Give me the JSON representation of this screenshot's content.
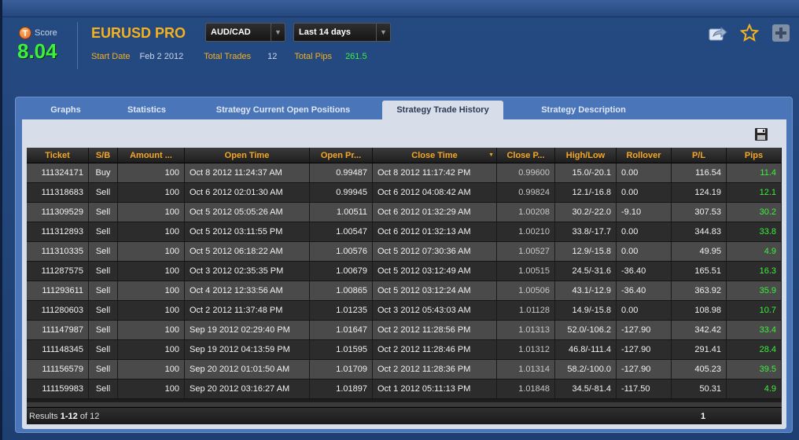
{
  "header": {
    "score_label": "Score",
    "score_icon_letter": "T",
    "score_value": "8.04",
    "strategy_name": "EURUSD PRO",
    "pair_select": "AUD/CAD",
    "period_select": "Last 14 days",
    "start_date_label": "Start Date",
    "start_date_value": "Feb 2 2012",
    "total_trades_label": "Total Trades",
    "total_trades_value": "12",
    "total_pips_label": "Total Pips",
    "total_pips_value": "261.5",
    "icons": [
      "share-icon",
      "star-icon",
      "plus-icon"
    ]
  },
  "tabs": [
    {
      "label": "Graphs",
      "active": false
    },
    {
      "label": "Statistics",
      "active": false
    },
    {
      "label": "Strategy Current Open Positions",
      "active": false
    },
    {
      "label": "Strategy Trade History",
      "active": true
    },
    {
      "label": "Strategy Description",
      "active": false
    }
  ],
  "grid": {
    "columns": [
      "Ticket",
      "S/B",
      "Amount ...",
      "Open Time",
      "Open Pr...",
      "Close Time",
      "Close P...",
      "High/Low",
      "Rollover",
      "P/L",
      "Pips"
    ],
    "rows": [
      [
        "111324171",
        "Buy",
        "100",
        "Oct 8 2012 11:24:37 AM",
        "0.99487",
        "Oct 8 2012 11:17:42 PM",
        "0.99600",
        "15.0/-20.1",
        "0.00",
        "116.54",
        "11.4"
      ],
      [
        "111318683",
        "Sell",
        "100",
        "Oct 6 2012 02:01:30 AM",
        "0.99945",
        "Oct 6 2012 04:08:42 AM",
        "0.99824",
        "12.1/-16.8",
        "0.00",
        "124.19",
        "12.1"
      ],
      [
        "111309529",
        "Sell",
        "100",
        "Oct 5 2012 05:05:26 AM",
        "1.00511",
        "Oct 6 2012 01:32:29 AM",
        "1.00208",
        "30.2/-22.0",
        "-9.10",
        "307.53",
        "30.2"
      ],
      [
        "111312893",
        "Sell",
        "100",
        "Oct 5 2012 03:11:55 PM",
        "1.00547",
        "Oct 6 2012 01:32:13 AM",
        "1.00210",
        "33.8/-17.7",
        "0.00",
        "344.83",
        "33.8"
      ],
      [
        "111310335",
        "Sell",
        "100",
        "Oct 5 2012 06:18:22 AM",
        "1.00576",
        "Oct 5 2012 07:30:36 AM",
        "1.00527",
        "12.9/-15.8",
        "0.00",
        "49.95",
        "4.9"
      ],
      [
        "111287575",
        "Sell",
        "100",
        "Oct 3 2012 02:35:35 PM",
        "1.00679",
        "Oct 5 2012 03:12:49 AM",
        "1.00515",
        "24.5/-31.6",
        "-36.40",
        "165.51",
        "16.3"
      ],
      [
        "111293611",
        "Sell",
        "100",
        "Oct 4 2012 12:33:56 AM",
        "1.00865",
        "Oct 5 2012 03:12:24 AM",
        "1.00506",
        "43.1/-12.9",
        "-36.40",
        "363.92",
        "35.9"
      ],
      [
        "111280603",
        "Sell",
        "100",
        "Oct 2 2012 11:37:48 PM",
        "1.01235",
        "Oct 3 2012 05:43:03 AM",
        "1.01128",
        "14.9/-15.8",
        "0.00",
        "108.98",
        "10.7"
      ],
      [
        "111147987",
        "Sell",
        "100",
        "Sep 19 2012 02:29:40 PM",
        "1.01647",
        "Oct 2 2012 11:28:56 PM",
        "1.01313",
        "52.0/-106.2",
        "-127.90",
        "342.42",
        "33.4"
      ],
      [
        "111148345",
        "Sell",
        "100",
        "Sep 19 2012 04:13:59 PM",
        "1.01595",
        "Oct 2 2012 11:28:46 PM",
        "1.01312",
        "46.8/-111.4",
        "-127.90",
        "291.41",
        "28.4"
      ],
      [
        "111156579",
        "Sell",
        "100",
        "Sep 20 2012 01:01:50 AM",
        "1.01709",
        "Oct 2 2012 11:28:36 PM",
        "1.01314",
        "58.2/-100.0",
        "-127.90",
        "405.23",
        "39.5"
      ],
      [
        "111159983",
        "Sell",
        "100",
        "Sep 20 2012 03:16:27 AM",
        "1.01897",
        "Oct 1 2012 05:11:13 PM",
        "1.01848",
        "34.5/-81.4",
        "-117.50",
        "50.31",
        "4.9"
      ]
    ]
  },
  "footer": {
    "results_prefix": "Results",
    "results_range": "1-12",
    "results_of": "of 12",
    "page": "1"
  }
}
